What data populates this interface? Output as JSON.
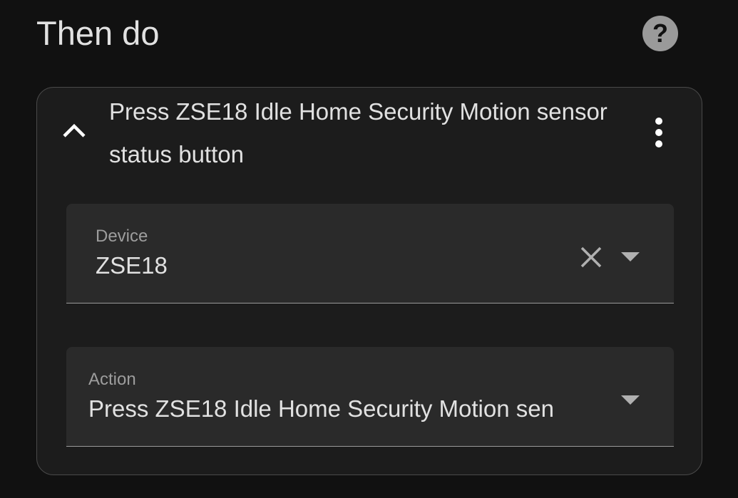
{
  "section": {
    "title": "Then do",
    "help_icon": "help-circle-icon"
  },
  "action_card": {
    "title": "Press ZSE18 Idle Home Security Motion sensor status button",
    "collapse_icon": "chevron-up-icon",
    "menu_icon": "dots-vertical-icon",
    "device_field": {
      "label": "Device",
      "value": "ZSE18",
      "clear_icon": "close-icon",
      "dropdown_icon": "menu-down-icon"
    },
    "action_field": {
      "label": "Action",
      "value": "Press ZSE18 Idle Home Security Motion sen",
      "dropdown_icon": "menu-down-icon"
    }
  },
  "colors": {
    "background": "#111111",
    "card": "#1c1c1c",
    "field": "#2a2a2a",
    "text": "#e1e1e1",
    "secondary_text": "#9d9d9d"
  }
}
